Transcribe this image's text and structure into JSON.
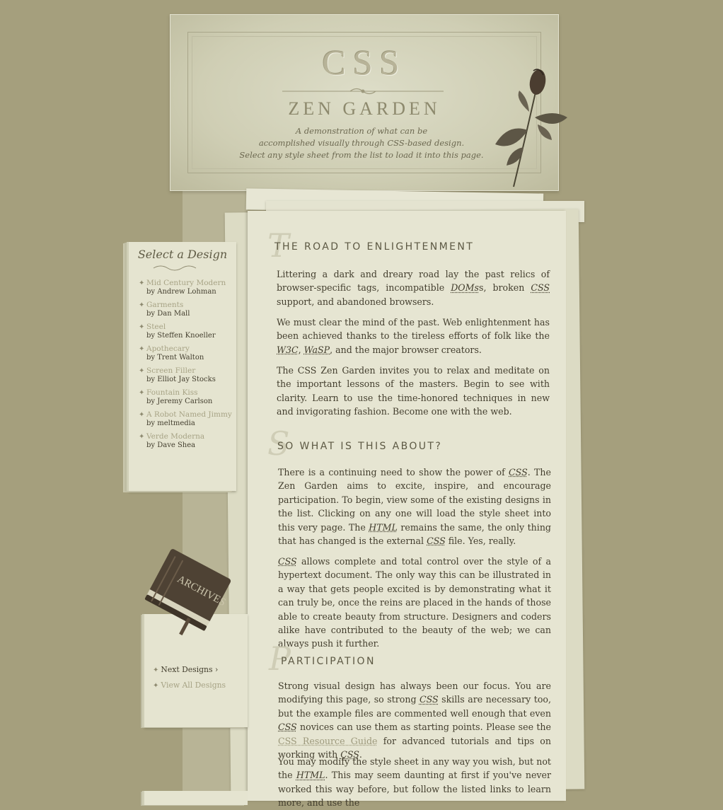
{
  "header": {
    "logo_top": "CSS",
    "logo_bottom": "ZEN GARDEN",
    "tagline": [
      "A demonstration of what can be",
      "accomplished visually through CSS-based design.",
      "Select any style sheet from the list to load it into this page."
    ]
  },
  "sections": {
    "road": {
      "drop": "T",
      "heading": "THE ROAD TO ENLIGHTENMENT",
      "p1": [
        "Littering a dark and dreary road lay the past relics of browser-specific tags, incompatible ",
        "DOMs",
        "s, broken ",
        "CSS",
        " support, and abandoned browsers."
      ],
      "p2": [
        "We must clear the mind of the past. Web enlightenment has been achieved thanks to the tireless efforts of folk like the ",
        "W3C",
        ", ",
        "WaSP",
        ", and the major browser creators."
      ],
      "p3": "The CSS Zen Garden invites you to relax and meditate on the important lessons of the masters. Begin to see with clarity. Learn to use the time-honored techniques in new and invigorating fashion. Become one with the web."
    },
    "about": {
      "drop": "S",
      "heading": "SO WHAT IS THIS ABOUT?",
      "p1": [
        "There is a continuing need to show the power of ",
        "CSS",
        ". The Zen Garden aims to excite, inspire, and encourage participation. To begin, view some of the existing designs in the list. Clicking on any one will load the style sheet into this very page. The ",
        "HTML",
        " remains the same, the only thing that has changed is the external ",
        "CSS",
        " file. Yes, really."
      ],
      "p2": [
        "CSS",
        " allows complete and total control over the style of a hypertext document. The only way this can be illustrated in a way that gets people excited is by demonstrating what it can truly be, once the reins are placed in the hands of those able to create beauty from structure. Designers and coders alike have contributed to the beauty of the web; we can always push it further."
      ]
    },
    "participation": {
      "drop": "P",
      "heading": "PARTICIPATION",
      "p1": [
        "Strong visual design has always been our focus. You are modifying this page, so strong ",
        "CSS",
        " skills are necessary too, but the example files are commented well enough that even ",
        "CSS",
        " novices can use them as starting points. Please see the ",
        "CSS Resource Guide",
        " for advanced tutorials and tips on working with ",
        "CSS",
        "."
      ],
      "p2": [
        "You may modify the style sheet in any way you wish, but not the ",
        "HTML",
        ". This may seem daunting at first if you've never worked this way before, but follow the listed links to learn more, and use the"
      ]
    }
  },
  "sidebar": {
    "title": "Select a Design",
    "designs": [
      {
        "name": "Mid Century Modern",
        "by": "by Andrew Lohman"
      },
      {
        "name": "Garments",
        "by": "by Dan Mall"
      },
      {
        "name": "Steel",
        "by": "by Steffen Knoeller"
      },
      {
        "name": "Apothecary",
        "by": "by Trent Walton"
      },
      {
        "name": "Screen Filler",
        "by": "by Elliot Jay Stocks"
      },
      {
        "name": "Fountain Kiss",
        "by": "by Jeremy Carlson"
      },
      {
        "name": "A Robot Named Jimmy",
        "by": "by meltmedia"
      },
      {
        "name": "Verde Moderna",
        "by": "by Dave Shea"
      }
    ],
    "archives_label": "ARCHIVES",
    "next_designs": "Next Designs ›",
    "view_all": "View All Designs"
  },
  "colors": {
    "background": "#a59f7d",
    "paper": "#e6e5d2",
    "link": "#a7a385",
    "text": "#433e2e"
  }
}
